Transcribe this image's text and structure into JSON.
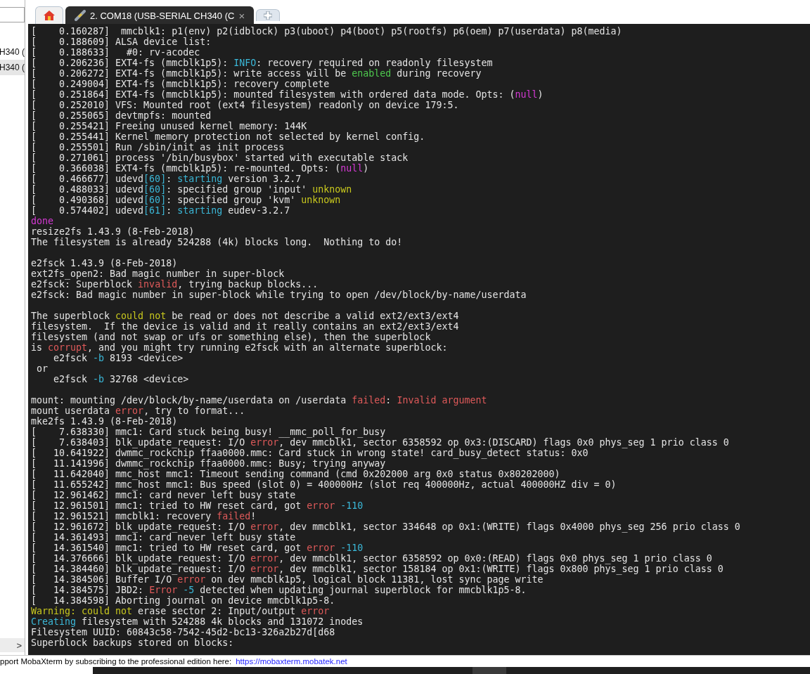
{
  "sidebar": {
    "items": [
      {
        "label": "H340 (",
        "selected": false
      },
      {
        "label": "H340 (",
        "selected": true
      }
    ],
    "scroll_arrow": ">"
  },
  "tabs": [
    {
      "kind": "home",
      "selected": false
    },
    {
      "kind": "session",
      "label": "2. COM18  (USB-SERIAL CH340 (C",
      "close": "×",
      "selected": true
    },
    {
      "kind": "new",
      "selected": false
    }
  ],
  "terminal": {
    "lines": [
      {
        "segments": [
          {
            "text": "[    0.160287]  mmcblk1: p1(env) p2(idblock) p3(uboot) p4(boot) p5(rootfs) p6(oem) p7(userdata) p8(media)"
          }
        ]
      },
      {
        "segments": [
          {
            "text": "[    0.188609] ALSA device list:"
          }
        ]
      },
      {
        "segments": [
          {
            "text": "[    0.188633]   #0: rv-acodec"
          }
        ]
      },
      {
        "segments": [
          {
            "text": "[    0.206236] EXT4-fs (mmcblk1p5): "
          },
          {
            "text": "INFO",
            "color": "#3bb8d8"
          },
          {
            "text": ": recovery required on readonly filesystem"
          }
        ]
      },
      {
        "segments": [
          {
            "text": "[    0.206272] EXT4-fs (mmcblk1p5): write access will be "
          },
          {
            "text": "enabled",
            "color": "#4ec94e"
          },
          {
            "text": " during recovery"
          }
        ]
      },
      {
        "segments": [
          {
            "text": "[    0.249004] EXT4-fs (mmcblk1p5): recovery complete"
          }
        ]
      },
      {
        "segments": [
          {
            "text": "[    0.251864] EXT4-fs (mmcblk1p5): mounted filesystem with ordered data mode. Opts: ("
          },
          {
            "text": "null",
            "color": "#d63ad6"
          },
          {
            "text": ")"
          }
        ]
      },
      {
        "segments": [
          {
            "text": "[    0.252010] VFS: Mounted root (ext4 filesystem) readonly on device 179:5."
          }
        ]
      },
      {
        "segments": [
          {
            "text": "[    0.255065] devtmpfs: mounted"
          }
        ]
      },
      {
        "segments": [
          {
            "text": "[    0.255421] Freeing unused kernel memory: 144K"
          }
        ]
      },
      {
        "segments": [
          {
            "text": "[    0.255441] Kernel memory protection not selected by kernel config."
          }
        ]
      },
      {
        "segments": [
          {
            "text": "[    0.255501] Run /sbin/init as init process"
          }
        ]
      },
      {
        "segments": [
          {
            "text": "[    0.271061] process '/bin/busybox' started with executable stack"
          }
        ]
      },
      {
        "segments": [
          {
            "text": "[    0.366038] EXT4-fs (mmcblk1p5): re-mounted. Opts: ("
          },
          {
            "text": "null",
            "color": "#d63ad6"
          },
          {
            "text": ")"
          }
        ]
      },
      {
        "segments": [
          {
            "text": "[    0.466677] udevd"
          },
          {
            "text": "[60]",
            "color": "#3bb8d8"
          },
          {
            "text": ": "
          },
          {
            "text": "starting",
            "color": "#3bb8d8"
          },
          {
            "text": " version 3.2.7"
          }
        ]
      },
      {
        "segments": [
          {
            "text": "[    0.488033] udevd"
          },
          {
            "text": "[60]",
            "color": "#3bb8d8"
          },
          {
            "text": ": specified group 'input' "
          },
          {
            "text": "unknown",
            "color": "#c8c81e"
          }
        ]
      },
      {
        "segments": [
          {
            "text": "[    0.490368] udevd"
          },
          {
            "text": "[60]",
            "color": "#3bb8d8"
          },
          {
            "text": ": specified group 'kvm' "
          },
          {
            "text": "unknown",
            "color": "#c8c81e"
          }
        ]
      },
      {
        "segments": [
          {
            "text": "[    0.574402] udevd"
          },
          {
            "text": "[61]",
            "color": "#3bb8d8"
          },
          {
            "text": ": "
          },
          {
            "text": "starting",
            "color": "#3bb8d8"
          },
          {
            "text": " eudev-3.2.7"
          }
        ]
      },
      {
        "segments": [
          {
            "text": "done",
            "color": "#d63ad6"
          }
        ]
      },
      {
        "segments": [
          {
            "text": "resize2fs 1.43.9 (8-Feb-2018)"
          }
        ]
      },
      {
        "segments": [
          {
            "text": "The filesystem is already 524288 (4k) blocks long.  Nothing to do!"
          }
        ]
      },
      {
        "blank_before": true,
        "segments": [
          {
            "text": "e2fsck 1.43.9 (8-Feb-2018)"
          }
        ]
      },
      {
        "segments": [
          {
            "text": "ext2fs_open2: Bad magic number in super-block"
          }
        ]
      },
      {
        "segments": [
          {
            "text": "e2fsck: Superblock "
          },
          {
            "text": "invalid",
            "color": "#e05a5a"
          },
          {
            "text": ", trying backup blocks..."
          }
        ]
      },
      {
        "segments": [
          {
            "text": "e2fsck: Bad magic number in super-block while trying to open /dev/block/by-name/userdata"
          }
        ]
      },
      {
        "blank_before": true,
        "segments": [
          {
            "text": "The superblock "
          },
          {
            "text": "could not",
            "color": "#c8c81e"
          },
          {
            "text": " be read or does not describe a valid ext2/ext3/ext4"
          }
        ]
      },
      {
        "segments": [
          {
            "text": "filesystem.  If the device is valid and it really contains an ext2/ext3/ext4"
          }
        ]
      },
      {
        "segments": [
          {
            "text": "filesystem (and not swap or ufs or something else), then the superblock"
          }
        ]
      },
      {
        "segments": [
          {
            "text": "is "
          },
          {
            "text": "corrupt",
            "color": "#e05a5a"
          },
          {
            "text": ", and you might try running e2fsck with an alternate superblock:"
          }
        ]
      },
      {
        "segments": [
          {
            "text": "    e2fsck "
          },
          {
            "text": "-b",
            "color": "#3bb8d8"
          },
          {
            "text": " 8193 <device>"
          }
        ]
      },
      {
        "segments": [
          {
            "text": " or"
          }
        ]
      },
      {
        "segments": [
          {
            "text": "    e2fsck "
          },
          {
            "text": "-b",
            "color": "#3bb8d8"
          },
          {
            "text": " 32768 <device>"
          }
        ]
      },
      {
        "blank_before": true,
        "segments": [
          {
            "text": "mount: mounting /dev/block/by-name/userdata on /userdata "
          },
          {
            "text": "failed",
            "color": "#e05a5a"
          },
          {
            "text": ": "
          },
          {
            "text": "Invalid argument",
            "color": "#e05a5a"
          }
        ]
      },
      {
        "segments": [
          {
            "text": "mount userdata "
          },
          {
            "text": "error",
            "color": "#e05a5a"
          },
          {
            "text": ", try to format..."
          }
        ]
      },
      {
        "segments": [
          {
            "text": "mke2fs 1.43.9 (8-Feb-2018)"
          }
        ]
      },
      {
        "segments": [
          {
            "text": "[    7.638330] mmc1: Card stuck being busy! __mmc_poll_for_busy"
          }
        ]
      },
      {
        "segments": [
          {
            "text": "[    7.638403] blk_update_request: I/O "
          },
          {
            "text": "error",
            "color": "#e05a5a"
          },
          {
            "text": ", dev mmcblk1, sector 6358592 op 0x3:(DISCARD) flags 0x0 phys_seg 1 prio class 0"
          }
        ]
      },
      {
        "segments": [
          {
            "text": "[   10.641922] dwmmc_rockchip ffaa0000.mmc: Card stuck in wrong state! card_busy_detect status: 0x0"
          }
        ]
      },
      {
        "segments": [
          {
            "text": "[   11.141996] dwmmc_rockchip ffaa0000.mmc: Busy; trying anyway"
          }
        ]
      },
      {
        "segments": [
          {
            "text": "[   11.642040] mmc_host mmc1: Timeout sending command (cmd 0x202000 arg 0x0 status 0x80202000)"
          }
        ]
      },
      {
        "segments": [
          {
            "text": "[   11.655242] mmc_host mmc1: Bus speed (slot 0) = 400000Hz (slot req 400000Hz, actual 400000HZ div = 0)"
          }
        ]
      },
      {
        "segments": [
          {
            "text": "[   12.961462] mmc1: card never left busy state"
          }
        ]
      },
      {
        "segments": [
          {
            "text": "[   12.961501] mmc1: tried to HW reset card, got "
          },
          {
            "text": "error",
            "color": "#e05a5a"
          },
          {
            "text": " -110",
            "color": "#3bb8d8"
          }
        ]
      },
      {
        "segments": [
          {
            "text": "[   12.961521] mmcblk1: recovery "
          },
          {
            "text": "failed",
            "color": "#e05a5a"
          },
          {
            "text": "!"
          }
        ]
      },
      {
        "segments": [
          {
            "text": "[   12.961672] blk_update_request: I/O "
          },
          {
            "text": "error",
            "color": "#e05a5a"
          },
          {
            "text": ", dev mmcblk1, sector 334648 op 0x1:(WRITE) flags 0x4000 phys_seg 256 prio class 0"
          }
        ]
      },
      {
        "segments": [
          {
            "text": "[   14.361493] mmc1: card never left busy state"
          }
        ]
      },
      {
        "segments": [
          {
            "text": "[   14.361540] mmc1: tried to HW reset card, got "
          },
          {
            "text": "error",
            "color": "#e05a5a"
          },
          {
            "text": " -110",
            "color": "#3bb8d8"
          }
        ]
      },
      {
        "segments": [
          {
            "text": "[   14.376666] blk_update_request: I/O "
          },
          {
            "text": "error",
            "color": "#e05a5a"
          },
          {
            "text": ", dev mmcblk1, sector 6358592 op 0x0:(READ) flags 0x0 phys_seg 1 prio class 0"
          }
        ]
      },
      {
        "segments": [
          {
            "text": "[   14.384460] blk_update_request: I/O "
          },
          {
            "text": "error",
            "color": "#e05a5a"
          },
          {
            "text": ", dev mmcblk1, sector 158184 op 0x1:(WRITE) flags 0x800 phys_seg 1 prio class 0"
          }
        ]
      },
      {
        "segments": [
          {
            "text": "[   14.384506] Buffer I/O "
          },
          {
            "text": "error",
            "color": "#e05a5a"
          },
          {
            "text": " on dev mmcblk1p5, logical block 11381, lost sync page write"
          }
        ]
      },
      {
        "segments": [
          {
            "text": "[   14.384575] JBD2: "
          },
          {
            "text": "Error",
            "color": "#e05a5a"
          },
          {
            "text": " -5",
            "color": "#3bb8d8"
          },
          {
            "text": " detected when updating journal superblock for mmcblk1p5-8."
          }
        ]
      },
      {
        "segments": [
          {
            "text": "[   14.384598] Aborting journal on device mmcblk1p5-8."
          }
        ]
      },
      {
        "segments": [
          {
            "text": "Warning: could not",
            "color": "#c8c81e"
          },
          {
            "text": " erase sector 2: Input/output "
          },
          {
            "text": "error",
            "color": "#e05a5a"
          }
        ]
      },
      {
        "segments": [
          {
            "text": "Creating",
            "color": "#3bb8d8"
          },
          {
            "text": " filesystem with 524288 4k blocks and 131072 inodes"
          }
        ]
      },
      {
        "segments": [
          {
            "text": "Filesystem UUID: 60843c58-7542-45d2-bc13-326a2b27d[d68"
          }
        ]
      },
      {
        "segments": [
          {
            "text": "Superblock backups stored on blocks:"
          }
        ]
      }
    ]
  },
  "status_bar": {
    "text": "pport MobaXterm by subscribing to the professional edition here:",
    "link": "https://mobaxterm.mobatek.net"
  }
}
